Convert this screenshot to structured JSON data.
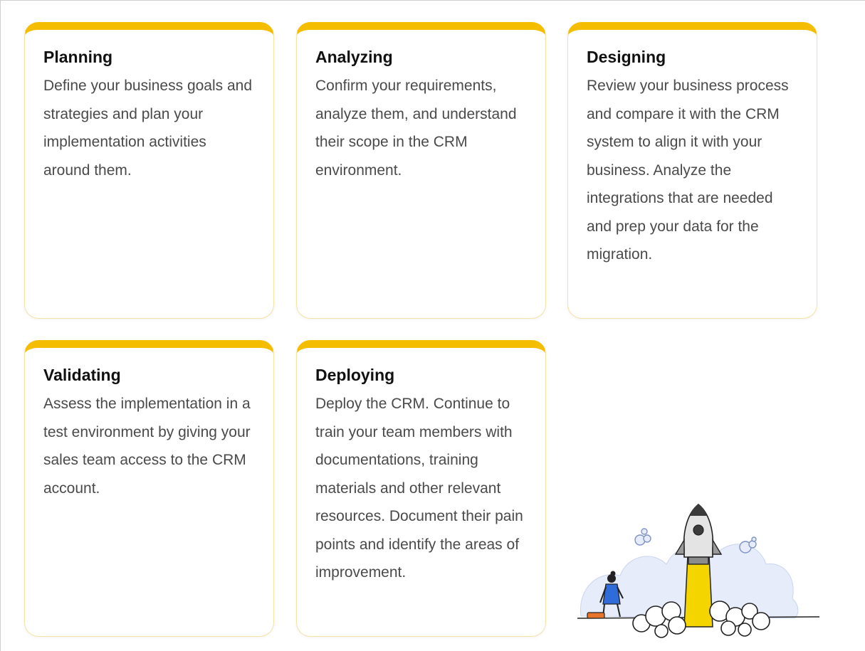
{
  "cards": [
    {
      "title": "Planning",
      "text": "Define your business goals and strategies and plan your implementation activities around them."
    },
    {
      "title": "Analyzing",
      "text": "Confirm your requirements, analyze them, and understand their scope in the CRM environment."
    },
    {
      "title": "Designing",
      "text": "Review your business process and compare it with the CRM system to align it with your business. Analyze the integrations that are needed and prep your data for the migration."
    },
    {
      "title": "Validating",
      "text": "Assess the implementation in a test environment by giving your sales team access to the CRM account."
    },
    {
      "title": "Deploying",
      "text": "Deploy the CRM. Continue to train your team members with documentations, training materials and other relevant resources. Document their pain points and identify the areas of improvement."
    }
  ],
  "illustration": {
    "icon": "rocket-launch-illustration",
    "accent_color": "#f4bd00",
    "cloud_color": "#e6ecfa",
    "figure_shirt_color": "#2f6bd9"
  }
}
